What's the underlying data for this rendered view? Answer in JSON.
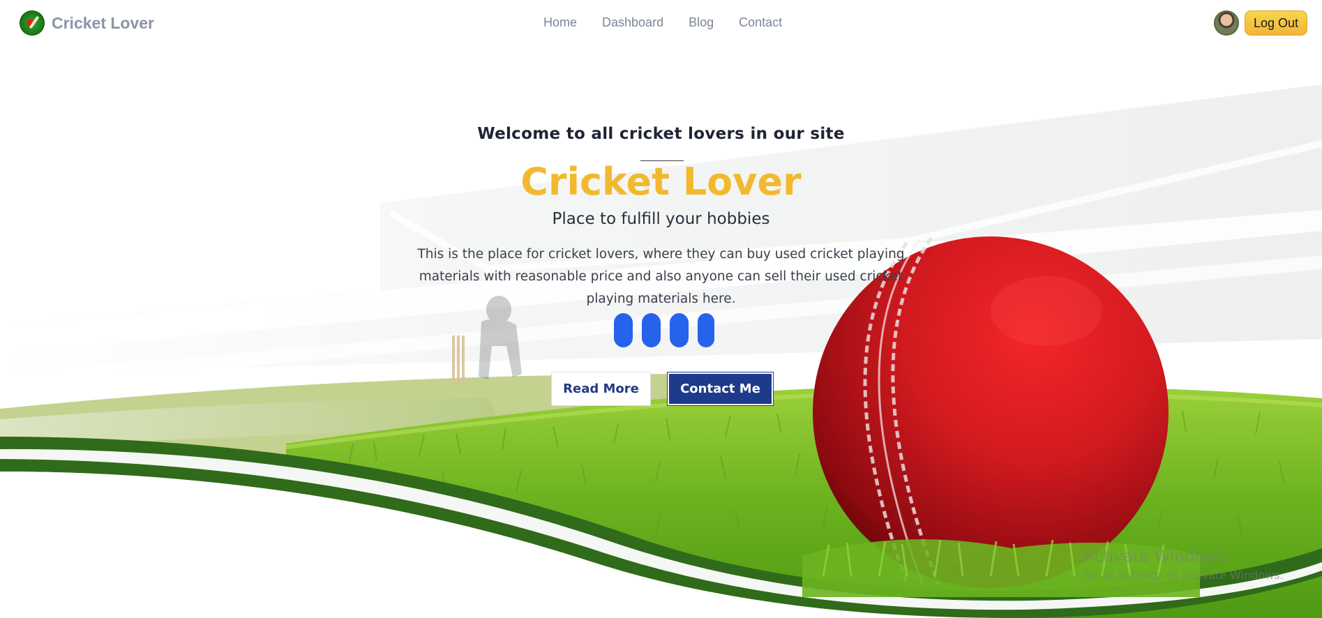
{
  "navbar": {
    "brand_name": "Cricket Lover",
    "links": [
      "Home",
      "Dashboard",
      "Blog",
      "Contact"
    ],
    "logout_label": "Log Out"
  },
  "hero": {
    "welcome": "Welcome to all cricket lovers in our site",
    "title": "Cricket Lover",
    "subtitle": "Place to fulfill your hobbies",
    "description": "This is the place for cricket lovers, where they can buy used cricket playing materials with reasonable price and also anyone can sell their used cricket playing materials here.",
    "read_more_label": "Read More",
    "contact_label": "Contact Me"
  },
  "watermark": {
    "title": "Activate Windows",
    "subtitle": "Go to Settings to activate Windows."
  },
  "colors": {
    "accent_title": "#f2b92f",
    "social_button": "#2563eb",
    "contact_button": "#1e3a8a",
    "logout_button": "#f2b53a"
  }
}
